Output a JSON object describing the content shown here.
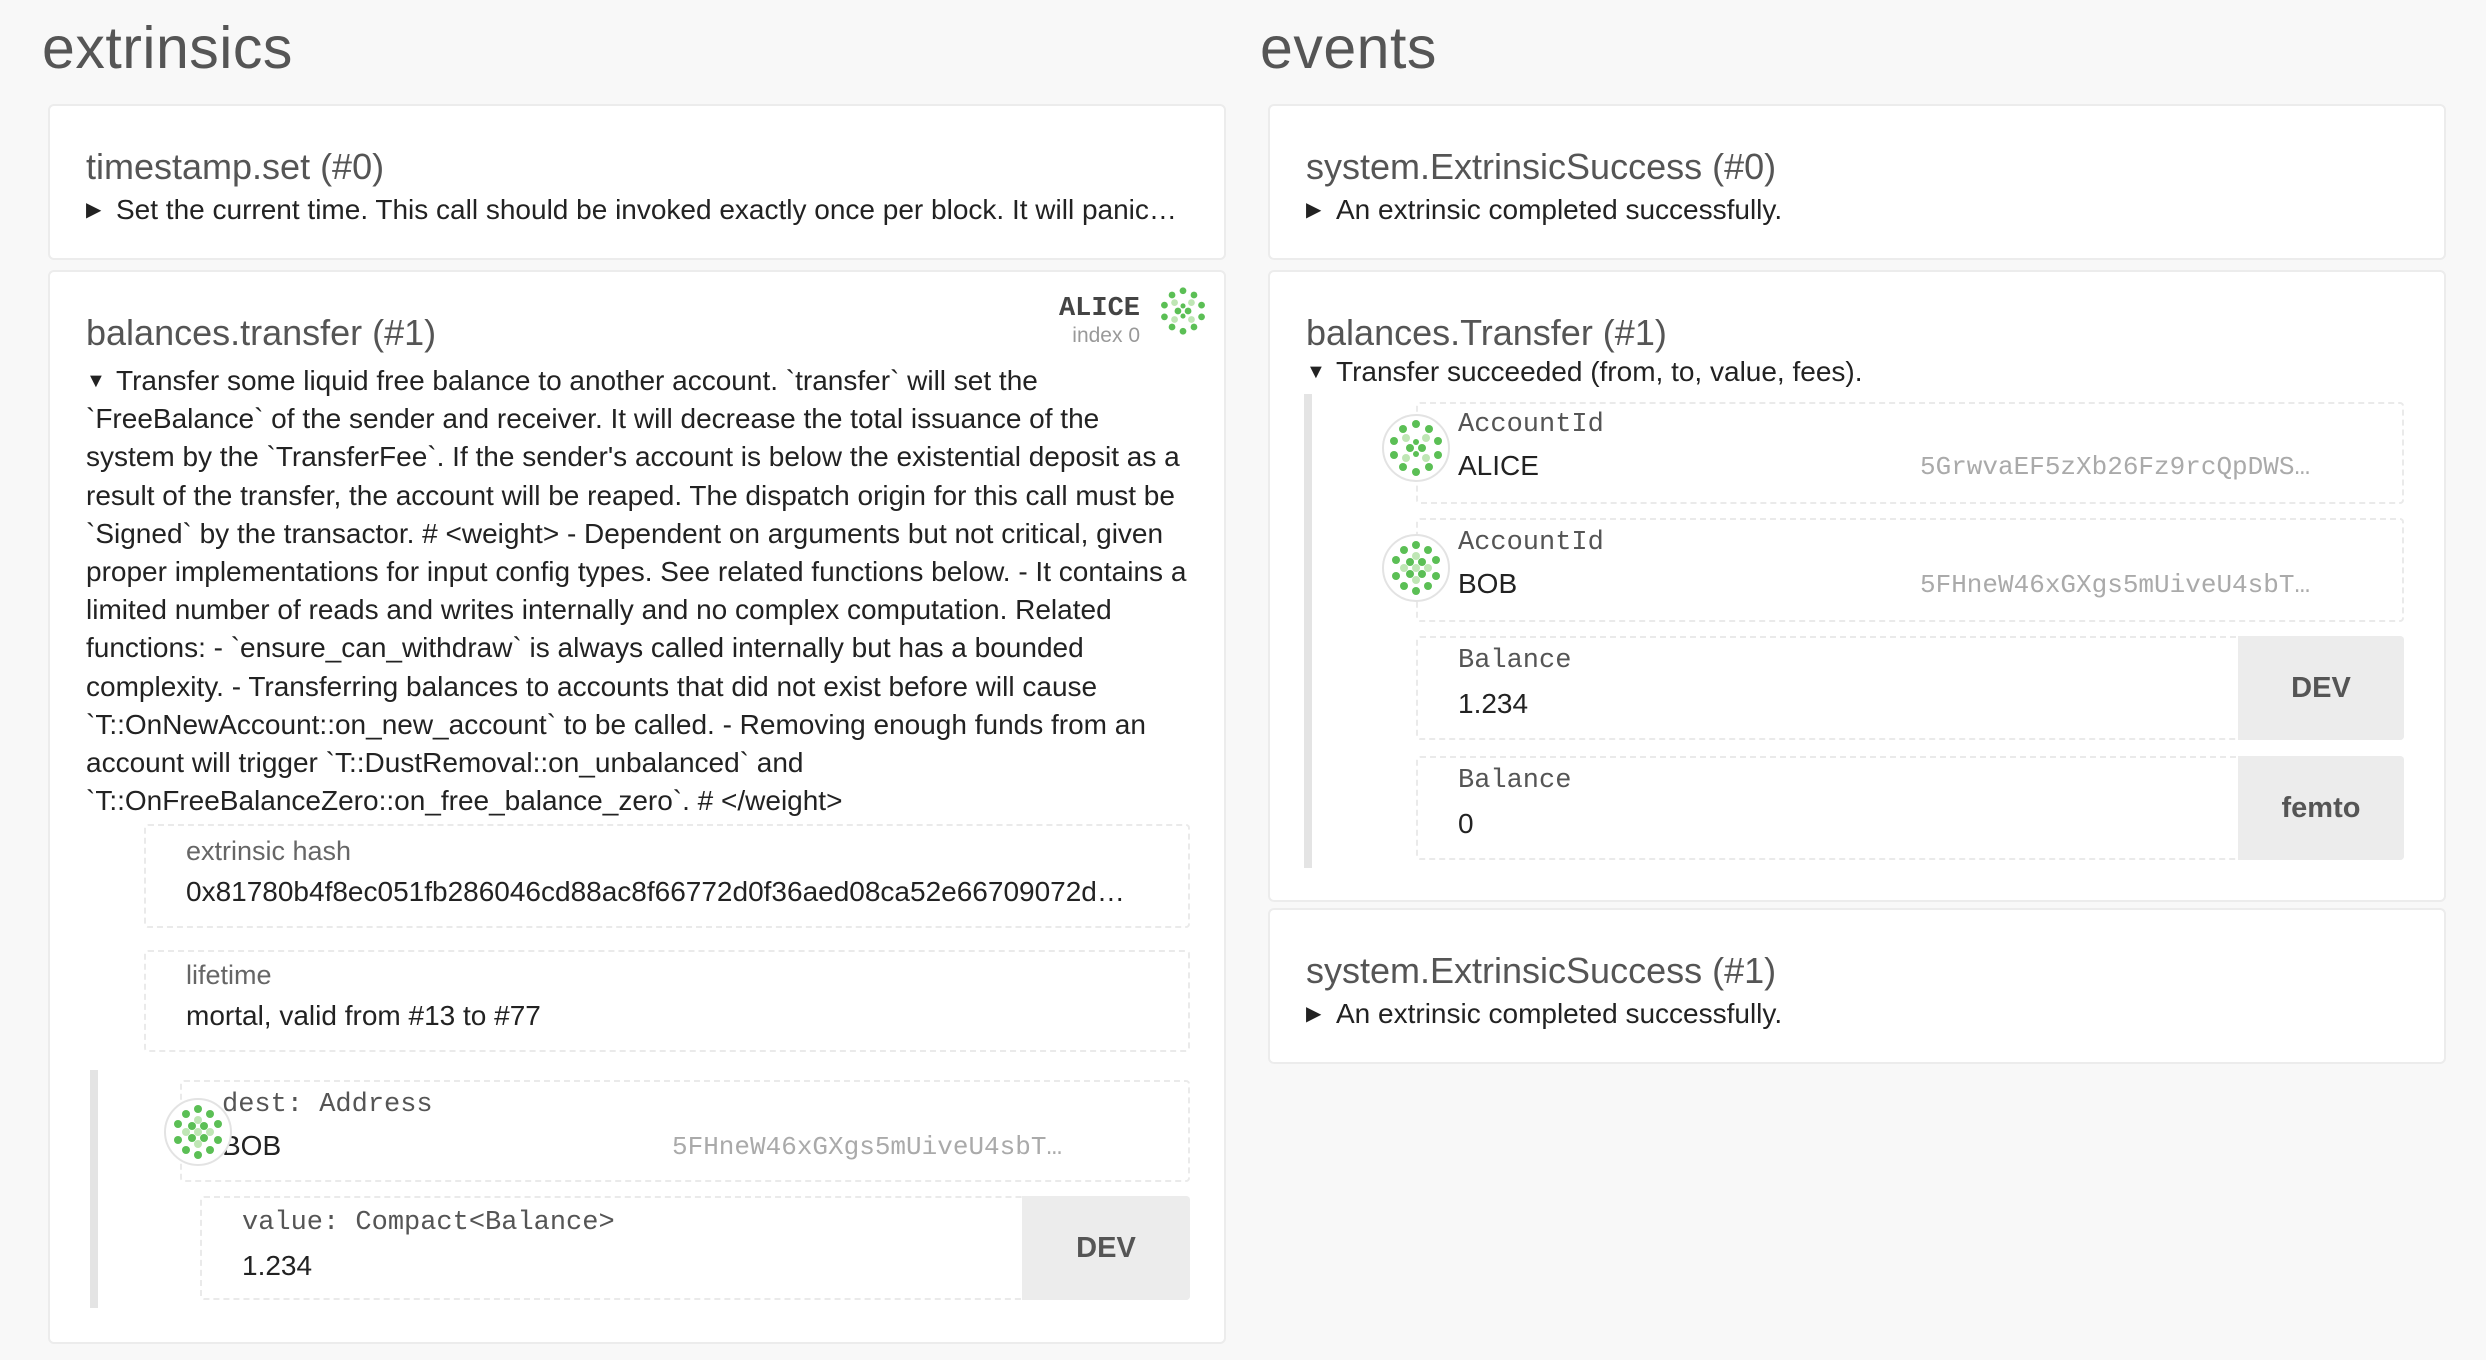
{
  "extrinsics": {
    "title": "extrinsics",
    "items": [
      {
        "title": "timestamp.set (#0)",
        "summary": "Set the current time. This call should be invoked exactly once per block. It will panic…"
      },
      {
        "title": "balances.transfer (#1)",
        "signer": {
          "name": "ALICE",
          "index": "index 0"
        },
        "doc_lines": [
          "Transfer some liquid free balance to another account. `transfer` will set the",
          "`FreeBalance` of the sender and receiver. It will decrease the total issuance of the",
          "system by the `TransferFee`. If the sender's account is below the existential deposit as a",
          "result of the transfer, the account will be reaped. The dispatch origin for this call must be",
          "`Signed` by the transactor. # <weight> - Dependent on arguments but not critical, given",
          "proper implementations for input config types. See related functions below. - It contains a",
          "limited number of reads and writes internally and no complex computation. Related",
          "functions: - `ensure_can_withdraw` is always called internally but has a bounded",
          "complexity. - Transferring balances to accounts that did not exist before will cause",
          "`T::OnNewAccount::on_new_account` to be called. - Removing enough funds from an",
          "account will trigger `T::DustRemoval::on_unbalanced` and",
          "`T::OnFreeBalanceZero::on_free_balance_zero`. # </weight>"
        ],
        "hash_label": "extrinsic hash",
        "hash_value": "0x81780b4f8ec051fb286046cd88ac8f66772d0f36aed08ca52e66709072d…",
        "lifetime_label": "lifetime",
        "lifetime_value": "mortal, valid from #13 to #77",
        "params": {
          "dest_label": "dest: Address",
          "dest_name": "BOB",
          "dest_address": "5FHneW46xGXgs5mUiveU4sbT…",
          "value_label": "value: Compact<Balance>",
          "value_amount": "1.234",
          "value_unit": "DEV"
        }
      }
    ]
  },
  "events": {
    "title": "events",
    "items": [
      {
        "title": "system.ExtrinsicSuccess (#0)",
        "summary": "An extrinsic completed successfully."
      },
      {
        "title": "balances.Transfer (#1)",
        "summary": "Transfer succeeded (from, to, value, fees).",
        "fields": [
          {
            "label": "AccountId",
            "name": "ALICE",
            "address": "5GrwvaEF5zXb26Fz9rcQpDWS…"
          },
          {
            "label": "AccountId",
            "name": "BOB",
            "address": "5FHneW46xGXgs5mUiveU4sbT…"
          },
          {
            "label": "Balance",
            "amount": "1.234",
            "unit": "DEV"
          },
          {
            "label": "Balance",
            "amount": "0",
            "unit": "femto"
          }
        ]
      },
      {
        "title": "system.ExtrinsicSuccess (#1)",
        "summary": "An extrinsic completed successfully."
      }
    ]
  },
  "glyphs": {
    "collapsed": "▶",
    "expanded": "▼"
  },
  "colors": {
    "identicon_green": "#5bbf55",
    "identicon_light": "#bfe6b5"
  }
}
